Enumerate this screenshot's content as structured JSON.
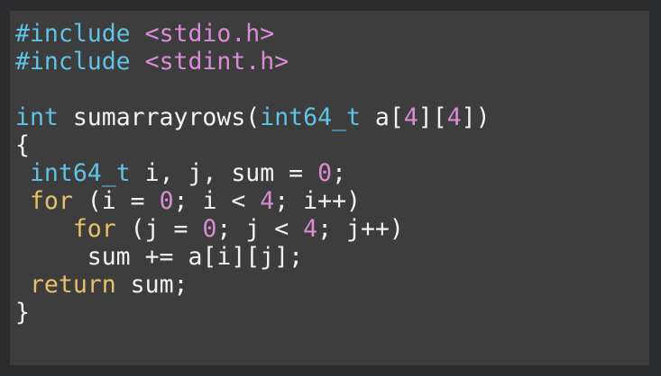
{
  "colors": {
    "background": "#3d3d3d",
    "frame": "#2b2c2e",
    "text": "#f2f2f2",
    "directive": "#5fc3e6",
    "header": "#d98cd6",
    "type": "#5fc3e6",
    "keyword": "#e8c06c",
    "number": "#d98cd6"
  },
  "code": {
    "lines": [
      [
        {
          "t": "#include",
          "k": "directive"
        },
        {
          "t": " ",
          "k": "punct"
        },
        {
          "t": "<stdio.h>",
          "k": "header"
        }
      ],
      [
        {
          "t": "#include",
          "k": "directive"
        },
        {
          "t": " ",
          "k": "punct"
        },
        {
          "t": "<stdint.h>",
          "k": "header"
        }
      ],
      [],
      [
        {
          "t": "int",
          "k": "type"
        },
        {
          "t": " sumarrayrows(",
          "k": "ident"
        },
        {
          "t": "int64_t",
          "k": "type"
        },
        {
          "t": " a[",
          "k": "ident"
        },
        {
          "t": "4",
          "k": "number"
        },
        {
          "t": "][",
          "k": "ident"
        },
        {
          "t": "4",
          "k": "number"
        },
        {
          "t": "])",
          "k": "ident"
        }
      ],
      [
        {
          "t": "{",
          "k": "ident"
        }
      ],
      [
        {
          "t": " ",
          "k": "punct"
        },
        {
          "t": "int64_t",
          "k": "type"
        },
        {
          "t": " i, j, sum = ",
          "k": "ident"
        },
        {
          "t": "0",
          "k": "number"
        },
        {
          "t": ";",
          "k": "ident"
        }
      ],
      [
        {
          "t": " ",
          "k": "punct"
        },
        {
          "t": "for",
          "k": "keyword"
        },
        {
          "t": " (i = ",
          "k": "ident"
        },
        {
          "t": "0",
          "k": "number"
        },
        {
          "t": "; i < ",
          "k": "ident"
        },
        {
          "t": "4",
          "k": "number"
        },
        {
          "t": "; i++)",
          "k": "ident"
        }
      ],
      [
        {
          "t": "    ",
          "k": "punct"
        },
        {
          "t": "for",
          "k": "keyword"
        },
        {
          "t": " (j = ",
          "k": "ident"
        },
        {
          "t": "0",
          "k": "number"
        },
        {
          "t": "; j < ",
          "k": "ident"
        },
        {
          "t": "4",
          "k": "number"
        },
        {
          "t": "; j++)",
          "k": "ident"
        }
      ],
      [
        {
          "t": "     sum += a[i][j];",
          "k": "ident"
        }
      ],
      [
        {
          "t": " ",
          "k": "punct"
        },
        {
          "t": "return",
          "k": "keyword"
        },
        {
          "t": " sum;",
          "k": "ident"
        }
      ],
      [
        {
          "t": "}",
          "k": "ident"
        }
      ]
    ]
  }
}
